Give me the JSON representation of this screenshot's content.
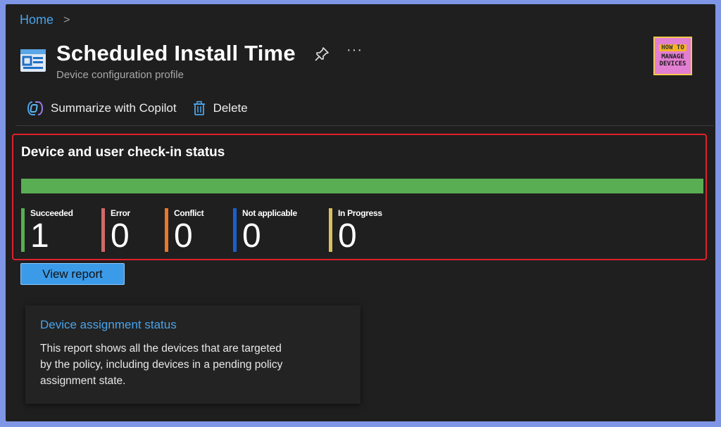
{
  "breadcrumb": {
    "home": "Home",
    "separator": ">"
  },
  "header": {
    "title": "Scheduled Install Time",
    "subtitle": "Device configuration profile",
    "more_label": "···",
    "icon": "profile-icon",
    "pin_icon": "pin-icon"
  },
  "logo": {
    "line1": "HOW TO",
    "line2": "MANAGE",
    "line3": "DEVICES"
  },
  "toolbar": {
    "copilot_label": "Summarize with Copilot",
    "delete_label": "Delete"
  },
  "status": {
    "title": "Device and user check-in status",
    "bar_color": "#59ad52",
    "items": [
      {
        "label": "Succeeded",
        "value": "1",
        "color": "#59ad52"
      },
      {
        "label": "Error",
        "value": "0",
        "color": "#d06a6a"
      },
      {
        "label": "Conflict",
        "value": "0",
        "color": "#e8782c"
      },
      {
        "label": "Not applicable",
        "value": "0",
        "color": "#1b5fcf"
      },
      {
        "label": "In Progress",
        "value": "0",
        "color": "#d9c061"
      }
    ]
  },
  "view_report_label": "View report",
  "assignment_card": {
    "title": "Device assignment status",
    "description": "This report shows all the devices that are targeted by the policy, including devices in a pending policy assignment state."
  }
}
